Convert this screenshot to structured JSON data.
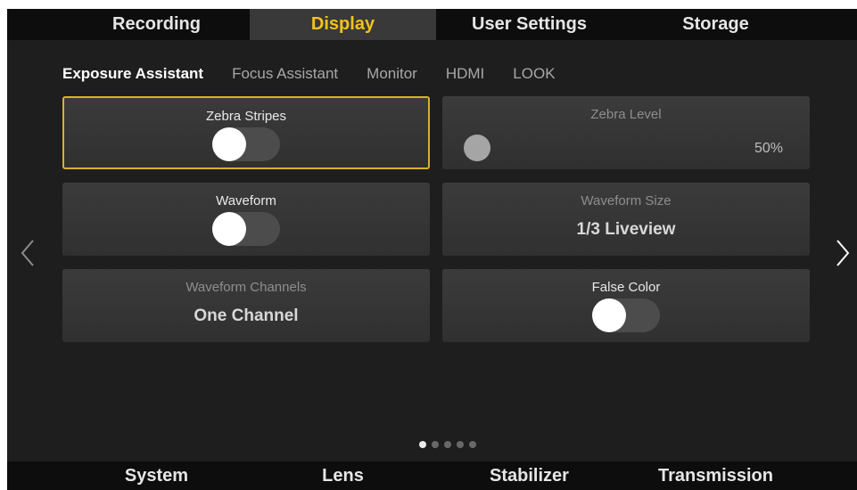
{
  "top_tabs": [
    {
      "label": "Recording",
      "active": false
    },
    {
      "label": "Display",
      "active": true
    },
    {
      "label": "User Settings",
      "active": false
    },
    {
      "label": "Storage",
      "active": false
    }
  ],
  "sub_tabs": [
    {
      "label": "Exposure Assistant",
      "active": true
    },
    {
      "label": "Focus Assistant",
      "active": false
    },
    {
      "label": "Monitor",
      "active": false
    },
    {
      "label": "HDMI",
      "active": false
    },
    {
      "label": "LOOK",
      "active": false
    }
  ],
  "cards": {
    "zebra_stripes": {
      "title": "Zebra Stripes",
      "state": "off",
      "selected": true
    },
    "zebra_level": {
      "title": "Zebra Level",
      "value": "50%",
      "enabled": false
    },
    "waveform": {
      "title": "Waveform",
      "state": "off"
    },
    "waveform_size": {
      "title": "Waveform Size",
      "value": "1/3 Liveview",
      "enabled": false
    },
    "waveform_channels": {
      "title": "Waveform Channels",
      "value": "One Channel",
      "enabled": false
    },
    "false_color": {
      "title": "False Color",
      "state": "off"
    }
  },
  "pagination": {
    "pages": 5,
    "current": 1
  },
  "nav": {
    "prev_icon": "chevron-left-icon",
    "next_icon": "chevron-right-icon"
  },
  "bottom_tabs": [
    {
      "label": "System"
    },
    {
      "label": "Lens"
    },
    {
      "label": "Stabilizer"
    },
    {
      "label": "Transmission"
    }
  ],
  "colors": {
    "accent": "#f0c419",
    "selection_border": "#d7b227",
    "background": "#1e1e1e",
    "bar": "#0d0d0d"
  }
}
